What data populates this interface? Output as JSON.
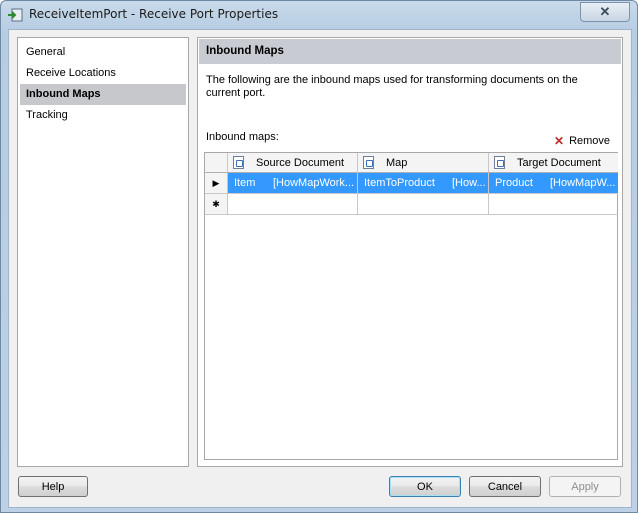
{
  "window": {
    "title": "ReceiveItemPort - Receive Port Properties",
    "close_label": "✕"
  },
  "nav": {
    "items": [
      {
        "label": "General",
        "selected": false
      },
      {
        "label": "Receive Locations",
        "selected": false
      },
      {
        "label": "Inbound Maps",
        "selected": true
      },
      {
        "label": "Tracking",
        "selected": false
      }
    ]
  },
  "panel": {
    "header": "Inbound Maps",
    "description": "The following are the inbound maps used for transforming documents on the current port.",
    "maps_label": "Inbound maps:",
    "remove_label": "Remove"
  },
  "grid": {
    "columns": [
      {
        "label": "Source Document",
        "icon": "document-schema-icon"
      },
      {
        "label": "Map",
        "icon": "map-icon"
      },
      {
        "label": "Target Document",
        "icon": "document-schema-icon"
      }
    ],
    "rows": [
      {
        "source_name": "Item",
        "source_assembly": "[HowMapWork...",
        "map_name": "ItemToProduct",
        "map_assembly": "[How...",
        "target_name": "Product",
        "target_assembly": "[HowMapW..."
      }
    ],
    "current_row_marker": "▶",
    "new_row_marker": "✱"
  },
  "buttons": {
    "help": "Help",
    "ok": "OK",
    "cancel": "Cancel",
    "apply": "Apply"
  },
  "colors": {
    "selection": "#3399ff",
    "nav_selected": "#c6c8cc",
    "remove_icon": "#c0282a"
  }
}
